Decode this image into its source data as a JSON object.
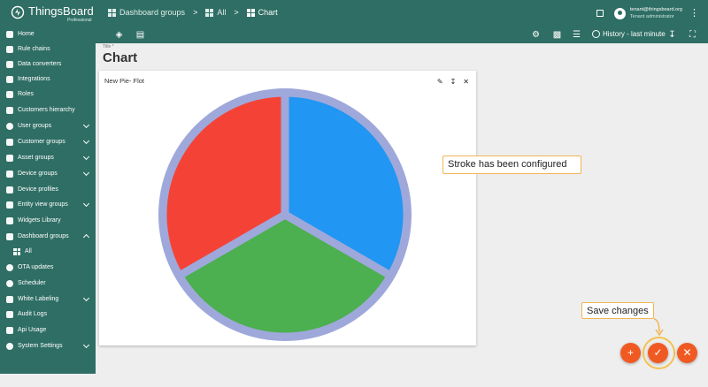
{
  "app": {
    "brand": "ThingsBoard",
    "edition": "Professional"
  },
  "breadcrumb": [
    {
      "label": "Dashboard groups"
    },
    {
      "label": "All"
    },
    {
      "label": "Chart"
    }
  ],
  "user": {
    "email": "tenant@thingsboard.org",
    "role": "Tenant administrator"
  },
  "toolbar": {
    "history_label": "History - last minute"
  },
  "sidebar": {
    "items": [
      {
        "label": "Home",
        "icon": "home-icon"
      },
      {
        "label": "Rule chains",
        "icon": "rule-chains-icon"
      },
      {
        "label": "Data converters",
        "icon": "data-converters-icon"
      },
      {
        "label": "Integrations",
        "icon": "integrations-icon"
      },
      {
        "label": "Roles",
        "icon": "shield-icon"
      },
      {
        "label": "Customers hierarchy",
        "icon": "hierarchy-icon"
      },
      {
        "label": "User groups",
        "icon": "account-icon",
        "expandable": true
      },
      {
        "label": "Customer groups",
        "icon": "people-icon",
        "expandable": true
      },
      {
        "label": "Asset groups",
        "icon": "asset-icon",
        "expandable": true
      },
      {
        "label": "Device groups",
        "icon": "device-icon",
        "expandable": true
      },
      {
        "label": "Device profiles",
        "icon": "device-profile-icon"
      },
      {
        "label": "Entity view groups",
        "icon": "entity-view-icon",
        "expandable": true
      },
      {
        "label": "Widgets Library",
        "icon": "widgets-icon"
      },
      {
        "label": "Dashboard groups",
        "icon": "dashboard-icon",
        "expandable": true,
        "expanded": true
      },
      {
        "label": "All",
        "icon": "grid-icon",
        "sub": true
      },
      {
        "label": "OTA updates",
        "icon": "ota-icon"
      },
      {
        "label": "Scheduler",
        "icon": "scheduler-icon"
      },
      {
        "label": "White Labeling",
        "icon": "palette-icon",
        "expandable": true
      },
      {
        "label": "Audit Logs",
        "icon": "audit-icon"
      },
      {
        "label": "Api Usage",
        "icon": "api-usage-icon"
      },
      {
        "label": "System Settings",
        "icon": "settings-icon",
        "expandable": true
      }
    ]
  },
  "page": {
    "title_label": "Title *",
    "title": "Chart"
  },
  "widget": {
    "title": "New Pie- Flot"
  },
  "chart_data": {
    "type": "pie",
    "title": "",
    "slices": [
      {
        "value": 1,
        "color": "#2196f3"
      },
      {
        "value": 1,
        "color": "#4caf50"
      },
      {
        "value": 1,
        "color": "#f44336"
      }
    ],
    "stroke_color": "#9fa8da"
  },
  "callouts": {
    "stroke": "Stroke has been configured",
    "save": "Save changes"
  },
  "colors": {
    "primary": "#2f6e64",
    "accent": "#f05a22",
    "callout_border": "#f2b552"
  }
}
